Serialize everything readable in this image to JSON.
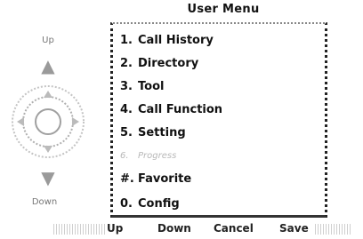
{
  "header": {
    "title": "User Menu"
  },
  "menu": {
    "items": [
      {
        "num": "1.",
        "label": "Call History",
        "enabled": true
      },
      {
        "num": "2.",
        "label": "Directory",
        "enabled": true
      },
      {
        "num": "3.",
        "label": "Tool",
        "enabled": true
      },
      {
        "num": "4.",
        "label": "Call Function",
        "enabled": true
      },
      {
        "num": "5.",
        "label": "Setting",
        "enabled": true
      },
      {
        "num": "6.",
        "label": "Progress",
        "enabled": false
      },
      {
        "num": "#.",
        "label": "Favorite",
        "enabled": true
      },
      {
        "num": "0.",
        "label": "Config",
        "enabled": true
      }
    ]
  },
  "nav": {
    "up_label": "Up",
    "down_label": "Down"
  },
  "softkeys": {
    "up": "Up",
    "down": "Down",
    "cancel": "Cancel",
    "save": "Save"
  },
  "icons": {
    "up": "chevron-up-icon",
    "down": "chevron-down-icon",
    "dpad": "navigation-pad-icon"
  },
  "colors": {
    "disabled_text": "#b8b8b8",
    "text": "#111111"
  }
}
